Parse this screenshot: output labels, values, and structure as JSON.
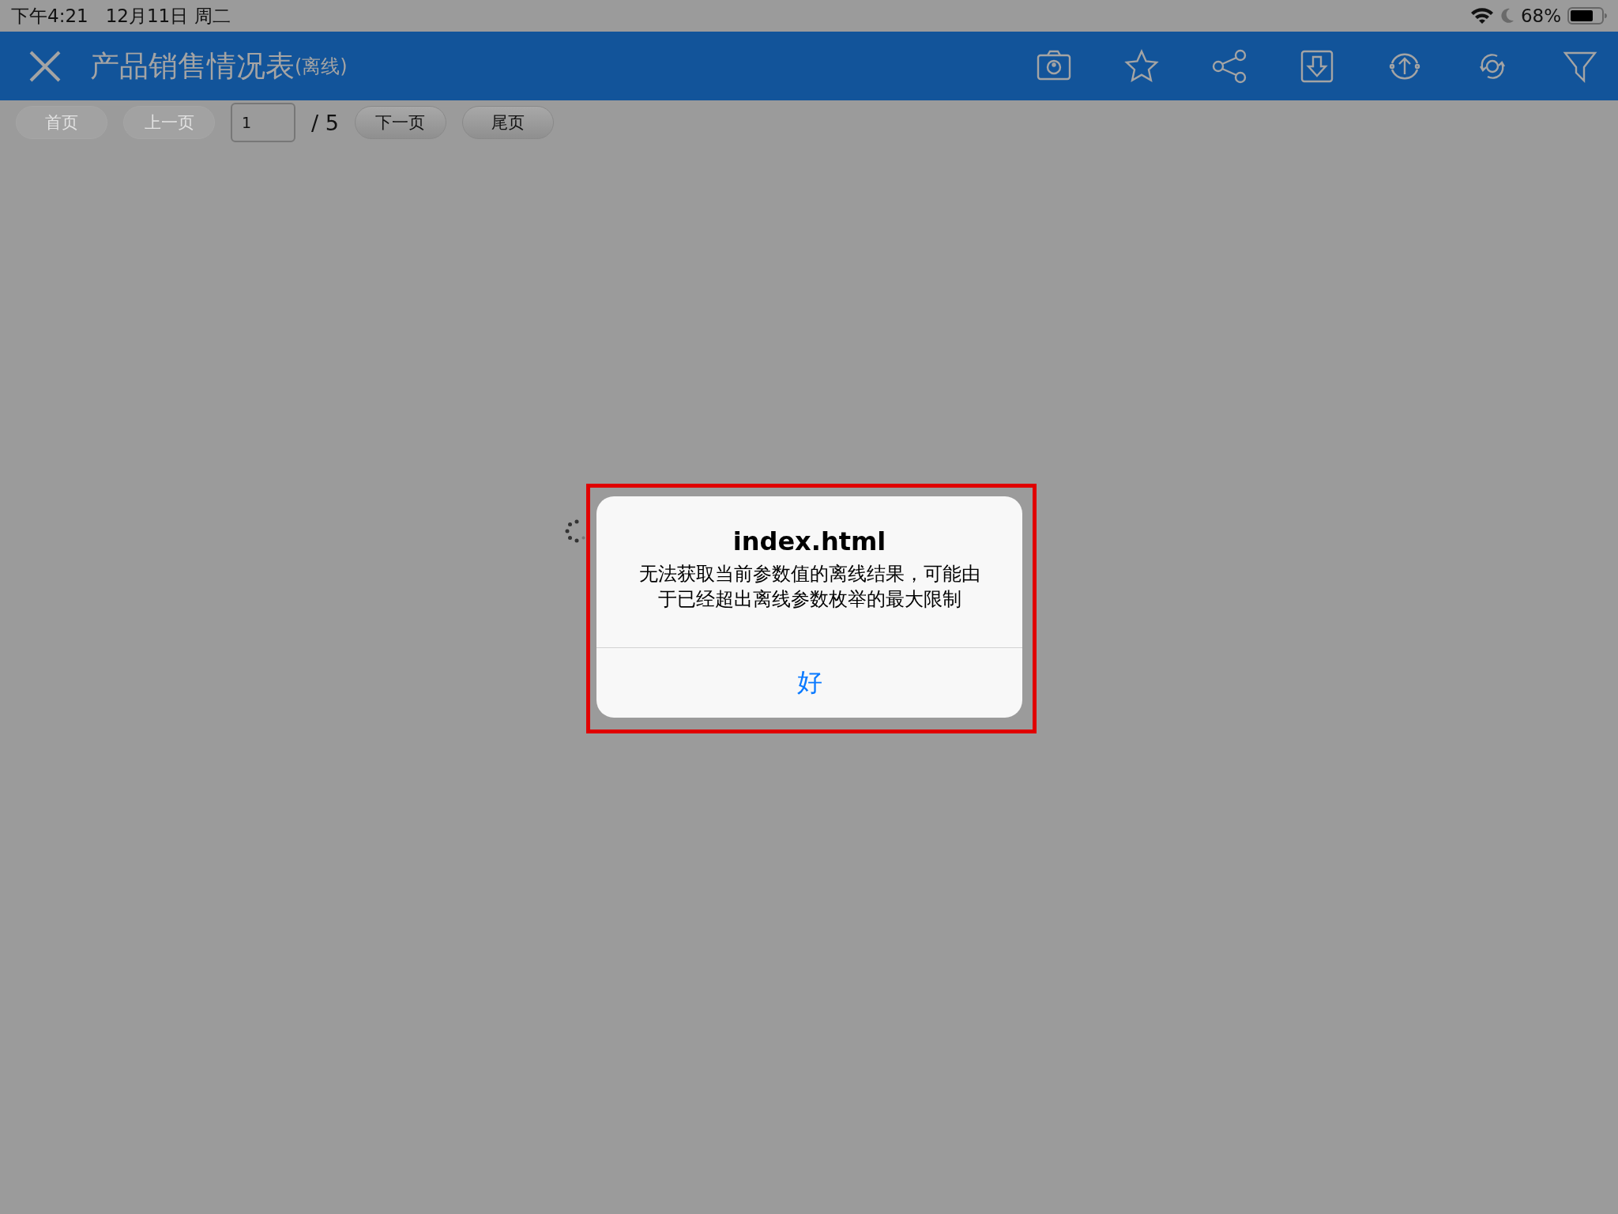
{
  "status_bar": {
    "time": "下午4:21",
    "date": "12月11日 周二",
    "battery": "68%"
  },
  "title_bar": {
    "title": "产品销售情况表",
    "title_suffix": "(离线)",
    "icons": [
      {
        "kind": "camera"
      },
      {
        "kind": "star"
      },
      {
        "kind": "share"
      },
      {
        "kind": "download"
      },
      {
        "kind": "upload"
      },
      {
        "kind": "refresh"
      },
      {
        "kind": "filter"
      }
    ]
  },
  "pager": {
    "buttons_before": [
      {
        "label": "首页",
        "disabled": true
      },
      {
        "label": "上一页",
        "disabled": true
      }
    ],
    "page_value": "1",
    "total": "/ 5",
    "buttons_after": [
      {
        "label": "下一页",
        "disabled": false
      },
      {
        "label": "尾页",
        "disabled": false
      }
    ]
  },
  "alert": {
    "title": "index.html",
    "message": "无法获取当前参数值的离线结果，可能由于已经超出离线参数枚举的最大限制",
    "button": "好"
  }
}
